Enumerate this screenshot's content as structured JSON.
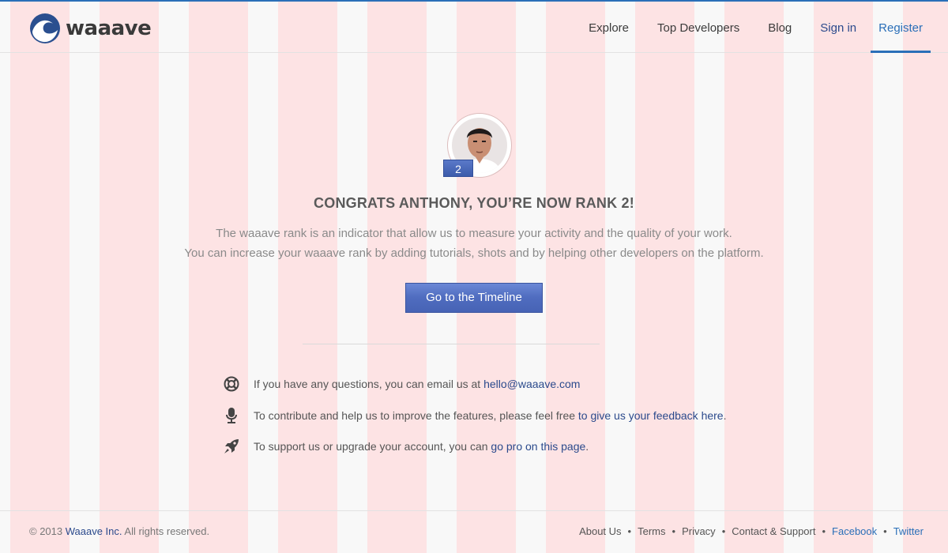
{
  "brand": {
    "name": "waaave"
  },
  "nav": {
    "explore": "Explore",
    "top_developers": "Top Developers",
    "blog": "Blog",
    "sign_in": "Sign in",
    "register": "Register"
  },
  "profile": {
    "rank": "2"
  },
  "main": {
    "congrats": "CONGRATS ANTHONY, YOU’RE NOW RANK 2!",
    "desc_line1": "The waaave rank is an indicator that allow us to measure your activity and the quality of your work.",
    "desc_line2": "You can increase your waaave rank by adding tutorials, shots and by helping other developers on the platform.",
    "cta": "Go to the Timeline"
  },
  "info": {
    "questions_text": "If you have any questions, you can email us at ",
    "questions_link": "hello@waaave.com",
    "feedback_text": "To contribute and help us to improve the features, please feel free ",
    "feedback_link": "to give us your feedback here",
    "feedback_end": ".",
    "pro_text": "To support us or upgrade your account, you can ",
    "pro_link": "go pro on this page",
    "pro_end": "."
  },
  "footer": {
    "copyright_prefix": "© 2013 ",
    "company": "Waaave Inc.",
    "rights": " All rights reserved.",
    "about": "About Us",
    "terms": "Terms",
    "privacy": "Privacy",
    "contact": "Contact & Support",
    "facebook": "Facebook",
    "twitter": "Twitter",
    "separator": "•"
  },
  "colors": {
    "accent": "#2a6fb8",
    "link": "#2b4a8c",
    "button": "#4f6cbf"
  }
}
